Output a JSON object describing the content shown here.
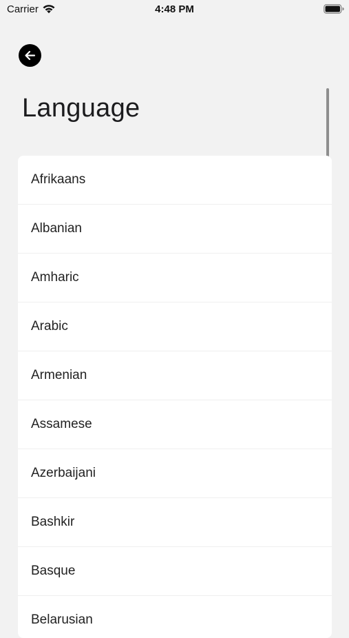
{
  "status_bar": {
    "carrier": "Carrier",
    "time": "4:48 PM",
    "wifi_icon": "wifi-icon",
    "battery_icon": "battery-icon"
  },
  "header": {
    "back_icon": "arrow-left-icon",
    "title": "Language"
  },
  "languages": [
    {
      "label": "Afrikaans"
    },
    {
      "label": "Albanian"
    },
    {
      "label": "Amharic"
    },
    {
      "label": "Arabic"
    },
    {
      "label": "Armenian"
    },
    {
      "label": "Assamese"
    },
    {
      "label": "Azerbaijani"
    },
    {
      "label": "Bashkir"
    },
    {
      "label": "Basque"
    },
    {
      "label": "Belarusian"
    }
  ],
  "colors": {
    "background": "#f2f2f2",
    "card": "#ffffff",
    "back_button": "#000000",
    "text": "#1c1c1e"
  }
}
